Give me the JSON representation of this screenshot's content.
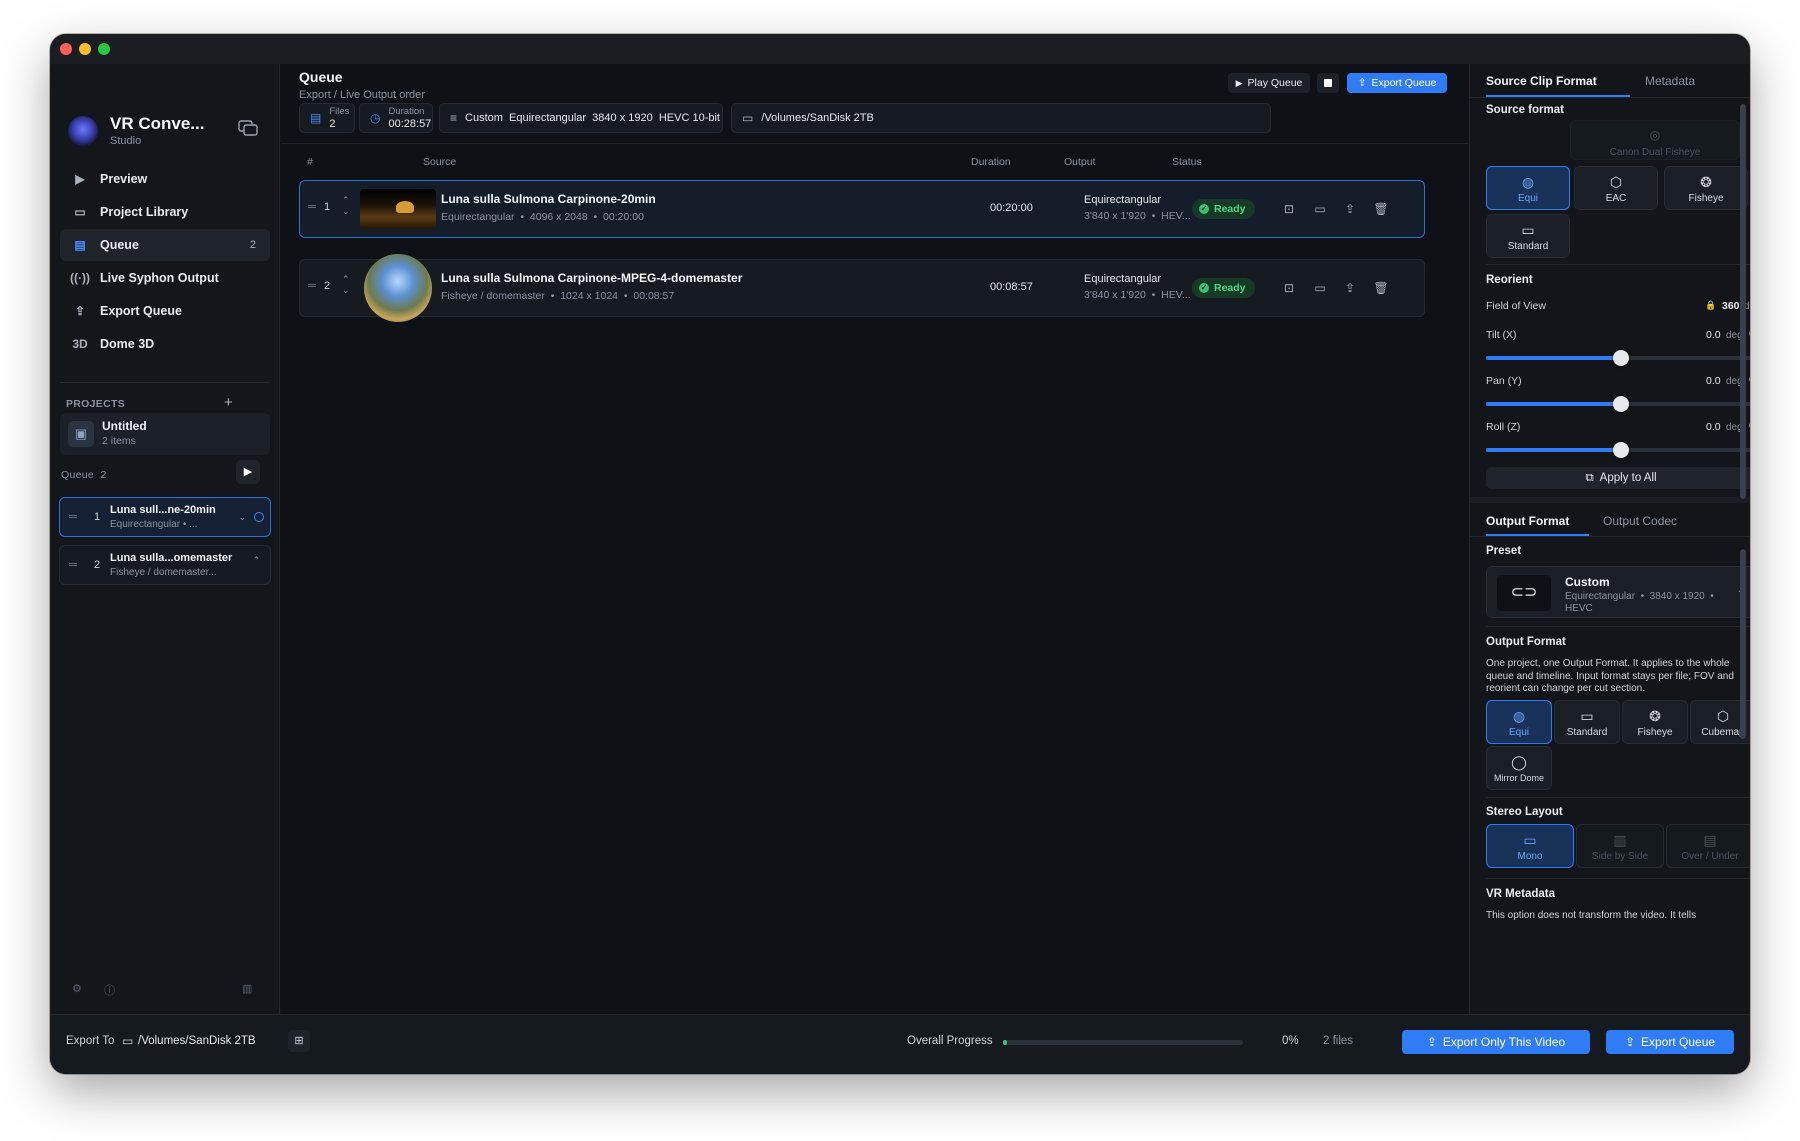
{
  "app": {
    "name": "VR Conve...",
    "subtitle": "Studio"
  },
  "nav": [
    {
      "label": "Preview",
      "icon": "play-square-icon"
    },
    {
      "label": "Project Library",
      "icon": "library-icon"
    },
    {
      "label": "Queue",
      "icon": "clipboard-icon",
      "count": "2"
    },
    {
      "label": "Live Syphon Output",
      "icon": "broadcast-icon"
    },
    {
      "label": "Export Queue",
      "icon": "share-icon"
    },
    {
      "label": "Dome 3D",
      "icon": "3d-icon",
      "icon_text": "3D"
    }
  ],
  "projects": {
    "label": "PROJECTS",
    "add": "+",
    "item": {
      "title": "Untitled",
      "sub": "2 items"
    }
  },
  "side_queue": {
    "label": "Queue",
    "count": "2",
    "items": [
      {
        "num": "1",
        "title": "Luna sull...ne-20min",
        "sub": "Equirectangular  •  ..."
      },
      {
        "num": "2",
        "title": "Luna sulla...omemaster",
        "sub": "Fisheye / domemaster..."
      }
    ]
  },
  "main": {
    "title": "Queue",
    "subtitle": "Export / Live Output order",
    "play_queue": "Play Queue",
    "export_queue": "Export Queue",
    "chips": {
      "files_label": "Files",
      "files_value": "2",
      "duration_label": "Duration",
      "duration_value": "00:28:57",
      "preset": "Custom  Equirectangular  3840 x 1920  HEVC 10-bit",
      "path": "/Volumes/SanDisk 2TB"
    },
    "columns": [
      "#",
      "Source",
      "Duration",
      "Output",
      "Status"
    ],
    "rows": [
      {
        "num": "1",
        "title": "Luna sulla Sulmona Carpinone-20min",
        "sub": "Equirectangular  •  4096 x 2048  •  00:20:00",
        "duration": "00:20:00",
        "out1": "Equirectangular",
        "out2": "3'840 x 1'920  •  HEV...",
        "status": "Ready"
      },
      {
        "num": "2",
        "title": "Luna sulla Sulmona Carpinone-MPEG-4-domemaster",
        "sub": "Fisheye / domemaster  •  1024 x 1024  •  00:08:57",
        "duration": "00:08:57",
        "out1": "Equirectangular",
        "out2": "3'840 x 1'920  •  HEV...",
        "status": "Ready"
      }
    ]
  },
  "right": {
    "tabs1": [
      "Source Clip Format",
      "Metadata"
    ],
    "source_format": "Source format",
    "canon": "Canon Dual Fisheye",
    "src_formats": [
      "Equi",
      "EAC",
      "Fisheye",
      "Standard"
    ],
    "reorient": "Reorient",
    "fov_label": "Field of View",
    "fov_value": "360",
    "fov_unit": "deg",
    "sliders": [
      {
        "label": "Tilt (X)",
        "value": "0.0",
        "unit": "deg",
        "fraction": 0.5
      },
      {
        "label": "Pan (Y)",
        "value": "0.0",
        "unit": "deg",
        "fraction": 0.5
      },
      {
        "label": "Roll (Z)",
        "value": "0.0",
        "unit": "deg",
        "fraction": 0.5
      }
    ],
    "apply": "Apply to All",
    "tabs2": [
      "Output Format",
      "Output Codec"
    ],
    "preset_label": "Preset",
    "preset": {
      "title": "Custom",
      "sub": "Equirectangular  •  3840 x 1920  •  HEVC"
    },
    "output_format_label": "Output Format",
    "output_desc": "One project, one Output Format. It applies to the whole queue and timeline. Input format stays per file; FOV and reorient can change per cut section.",
    "out_formats": [
      "Equi",
      "Standard",
      "Fisheye",
      "Cubemap",
      "Mirror Dome"
    ],
    "stereo_label": "Stereo Layout",
    "stereo": [
      "Mono",
      "Side by Side",
      "Over / Under"
    ],
    "vr_meta_label": "VR Metadata",
    "vr_meta_desc": "This option does not transform the video. It tells"
  },
  "bottom": {
    "export_to": "Export To",
    "path": "/Volumes/SanDisk 2TB",
    "overall": "Overall Progress",
    "progress": 0,
    "progress_text": "0%",
    "files": "2 files",
    "export_only": "Export Only This Video",
    "export_queue": "Export Queue"
  },
  "colors": {
    "accent": "#2f7cf6",
    "ready": "#4fd88a",
    "bg": "#0f1419"
  }
}
